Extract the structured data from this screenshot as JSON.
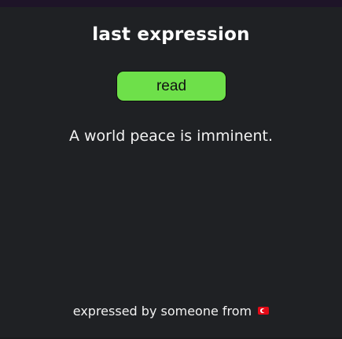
{
  "header": {
    "title": "last expression"
  },
  "actions": {
    "read_label": "read"
  },
  "expression": {
    "text": "A world peace is imminent."
  },
  "footer": {
    "text": "expressed by someone from",
    "flag_icon": "turkey-flag-icon"
  },
  "colors": {
    "background": "#1f2124",
    "top_bar": "#1e1428",
    "button": "#6ee04a",
    "text": "#ffffff"
  }
}
